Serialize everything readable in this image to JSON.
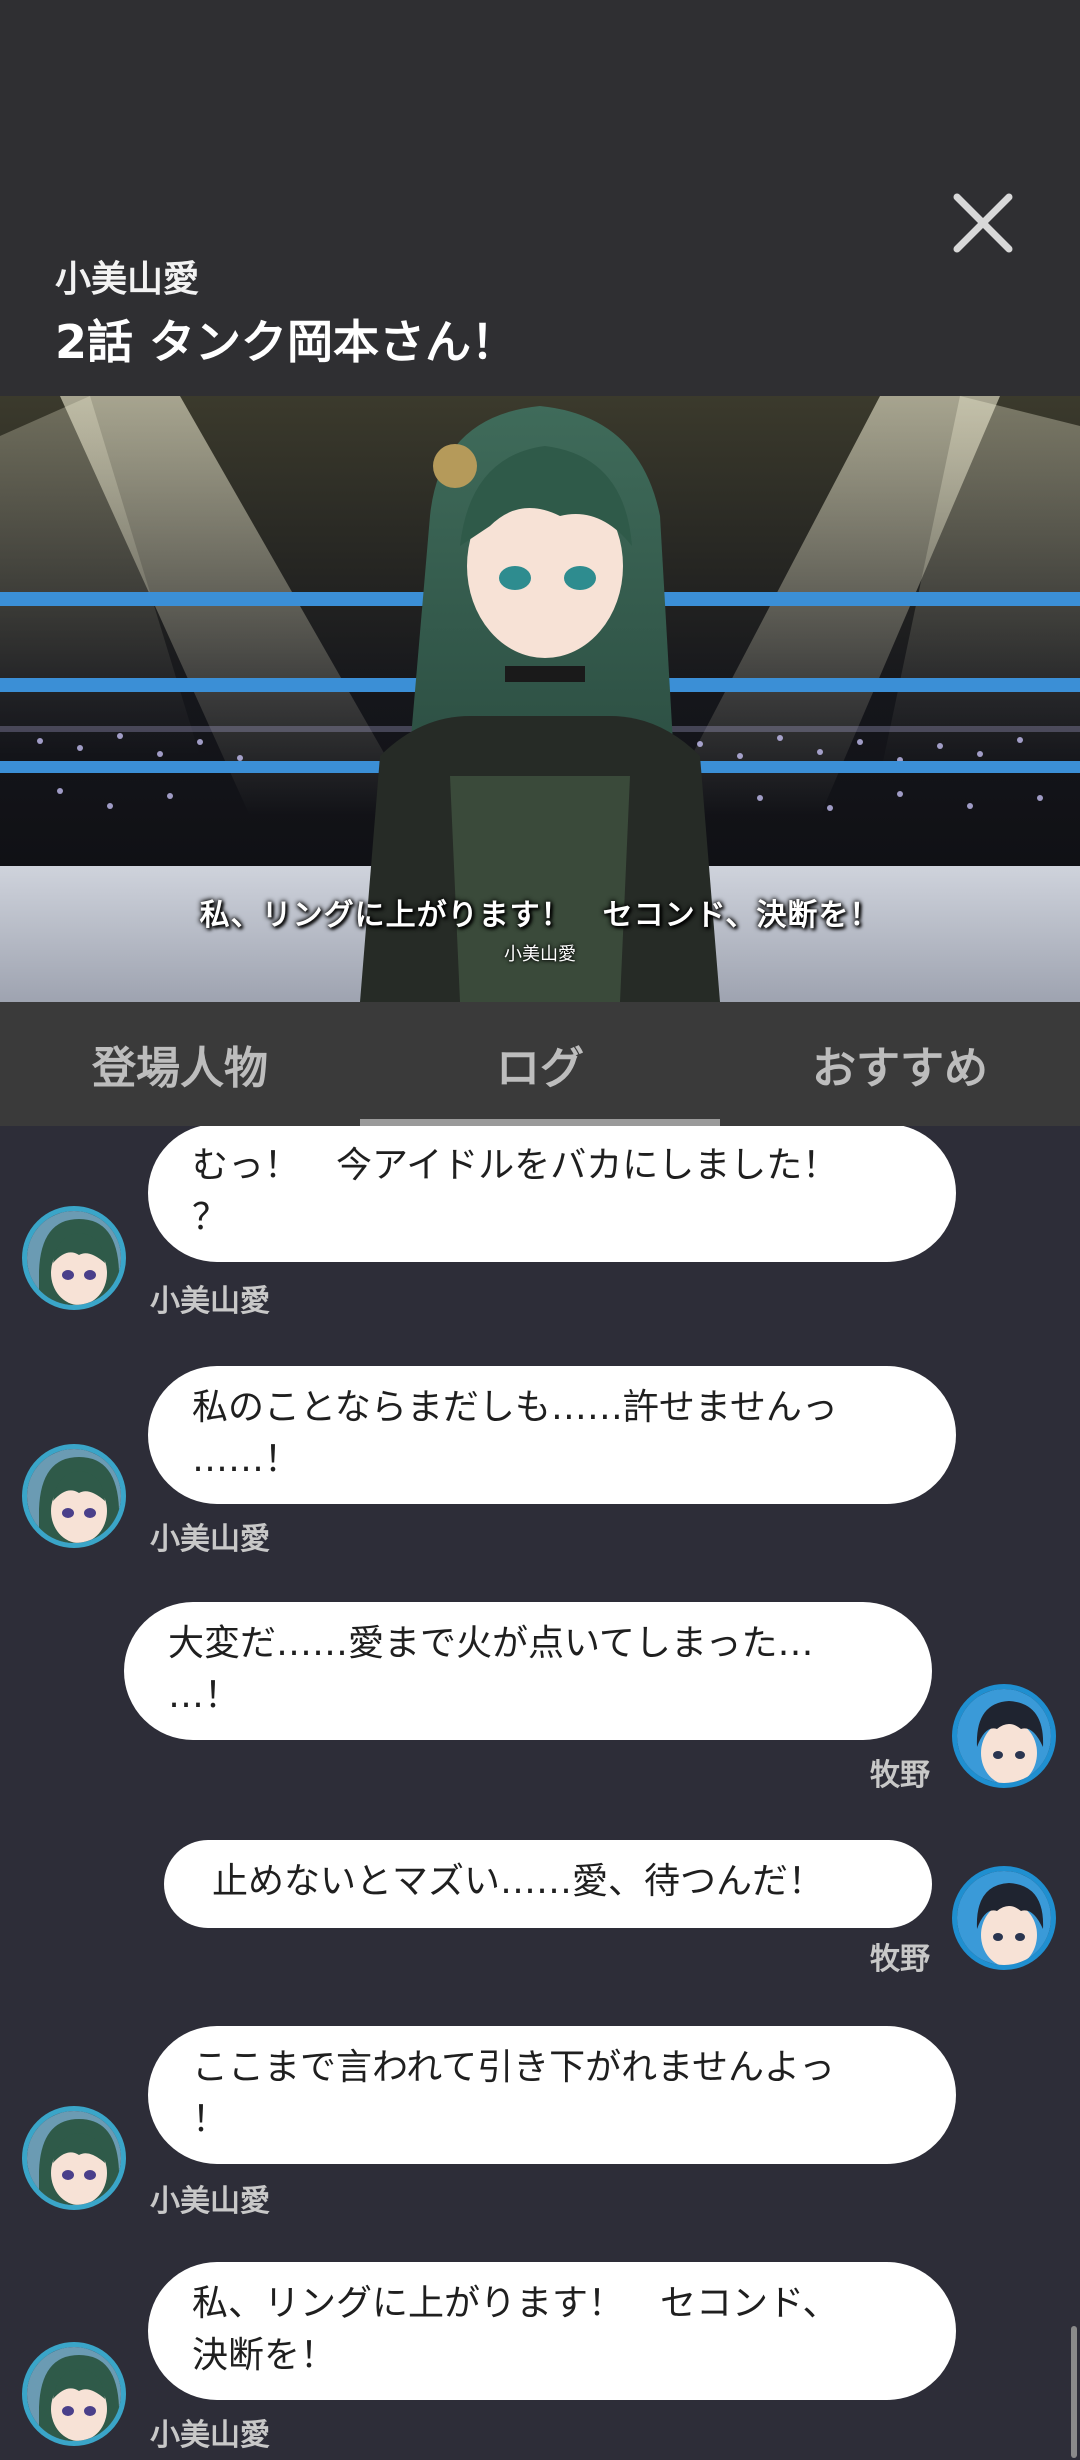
{
  "header": {
    "chapter_name": "小美山愛",
    "episode_title": "2話 タンク岡本さん！",
    "close_icon": "close-icon"
  },
  "video": {
    "subtitle": "私、リングに上がります！　セコンド、決断を！",
    "subtitle_speaker": "小美山愛",
    "progress_fraction": 0.9
  },
  "tabs": [
    {
      "label": "登場人物",
      "active": false
    },
    {
      "label": "ログ",
      "active": true
    },
    {
      "label": "おすすめ",
      "active": false
    }
  ],
  "log": {
    "messages": [
      {
        "speaker": "小美山愛",
        "side": "left",
        "text": "むっ！　今アイドルをバカにしました！\n？"
      },
      {
        "speaker": "小美山愛",
        "side": "left",
        "text": "私のことならまだしも……許せませんっ\n……！"
      },
      {
        "speaker": "牧野",
        "side": "right",
        "text": "大変だ……愛まで火が点いてしまった…\n…！"
      },
      {
        "speaker": "牧野",
        "side": "right",
        "text": "止めないとマズい……愛、待つんだ！"
      },
      {
        "speaker": "小美山愛",
        "side": "left",
        "text": "ここまで言われて引き下がれませんよっ\n！"
      },
      {
        "speaker": "小美山愛",
        "side": "left",
        "text": "私、リングに上がります！　セコンド、\n決断を！"
      }
    ]
  },
  "colors": {
    "progress": "#2b3de0",
    "background": "#2d2d38",
    "bubble": "#ffffff"
  }
}
